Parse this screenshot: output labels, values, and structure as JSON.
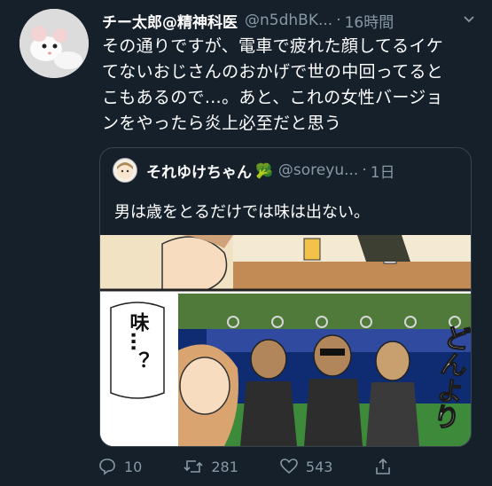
{
  "tweet": {
    "name": "チー太郎@精神科医",
    "handle": "@n5dhBK...",
    "separator": "·",
    "time": "16時間",
    "lines": [
      "その通りですが、電車で疲れた顔してるイケ",
      "てないおじさんのおかげで世の中回ってると",
      "こもあるので…。あと、これの女性バージョ",
      "ンをやったら炎上必至だと思う"
    ]
  },
  "quote": {
    "name": "それゆけちゃん",
    "emoji": "🥦",
    "handle": "@soreyu...",
    "separator": "·",
    "time": "1日",
    "text": "男は歳をとるだけでは味は出ない。",
    "manga": {
      "bubble_text": "味…？",
      "sfx": "どんより"
    }
  },
  "actions": {
    "reply_count": "10",
    "retweet_count": "281",
    "like_count": "543"
  },
  "colors": {
    "background": "#15202b",
    "secondary_text": "#8899a6",
    "border": "#38444d"
  }
}
